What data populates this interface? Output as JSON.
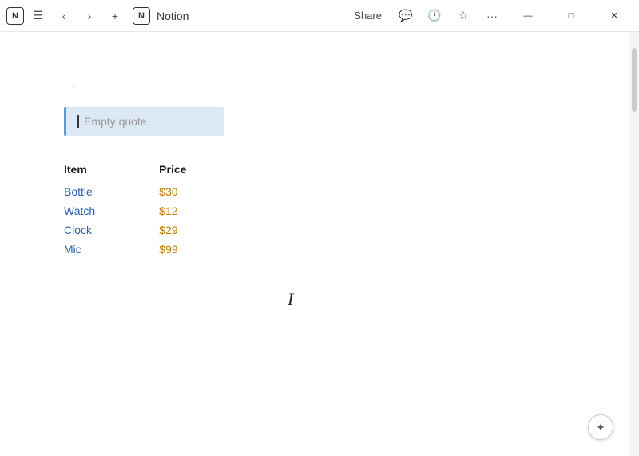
{
  "titlebar": {
    "app_name": "Notion",
    "share_label": "Share",
    "nav": {
      "back": "‹",
      "forward": "›",
      "add": "+",
      "menu": "☰"
    },
    "icons": {
      "comment": "💬",
      "history": "🕐",
      "star": "☆",
      "more": "···",
      "minimize": "—",
      "maximize": "□",
      "close": "✕"
    }
  },
  "page": {
    "dot": "·",
    "quote_placeholder": "Empty quote",
    "table": {
      "headers": [
        "Item",
        "Price"
      ],
      "rows": [
        {
          "item": "Bottle",
          "price": "$30"
        },
        {
          "item": "Watch",
          "price": "$12"
        },
        {
          "item": "Clock",
          "price": "$29"
        },
        {
          "item": "Mic",
          "price": "$99"
        }
      ]
    }
  },
  "corner_btn_icon": "✦"
}
